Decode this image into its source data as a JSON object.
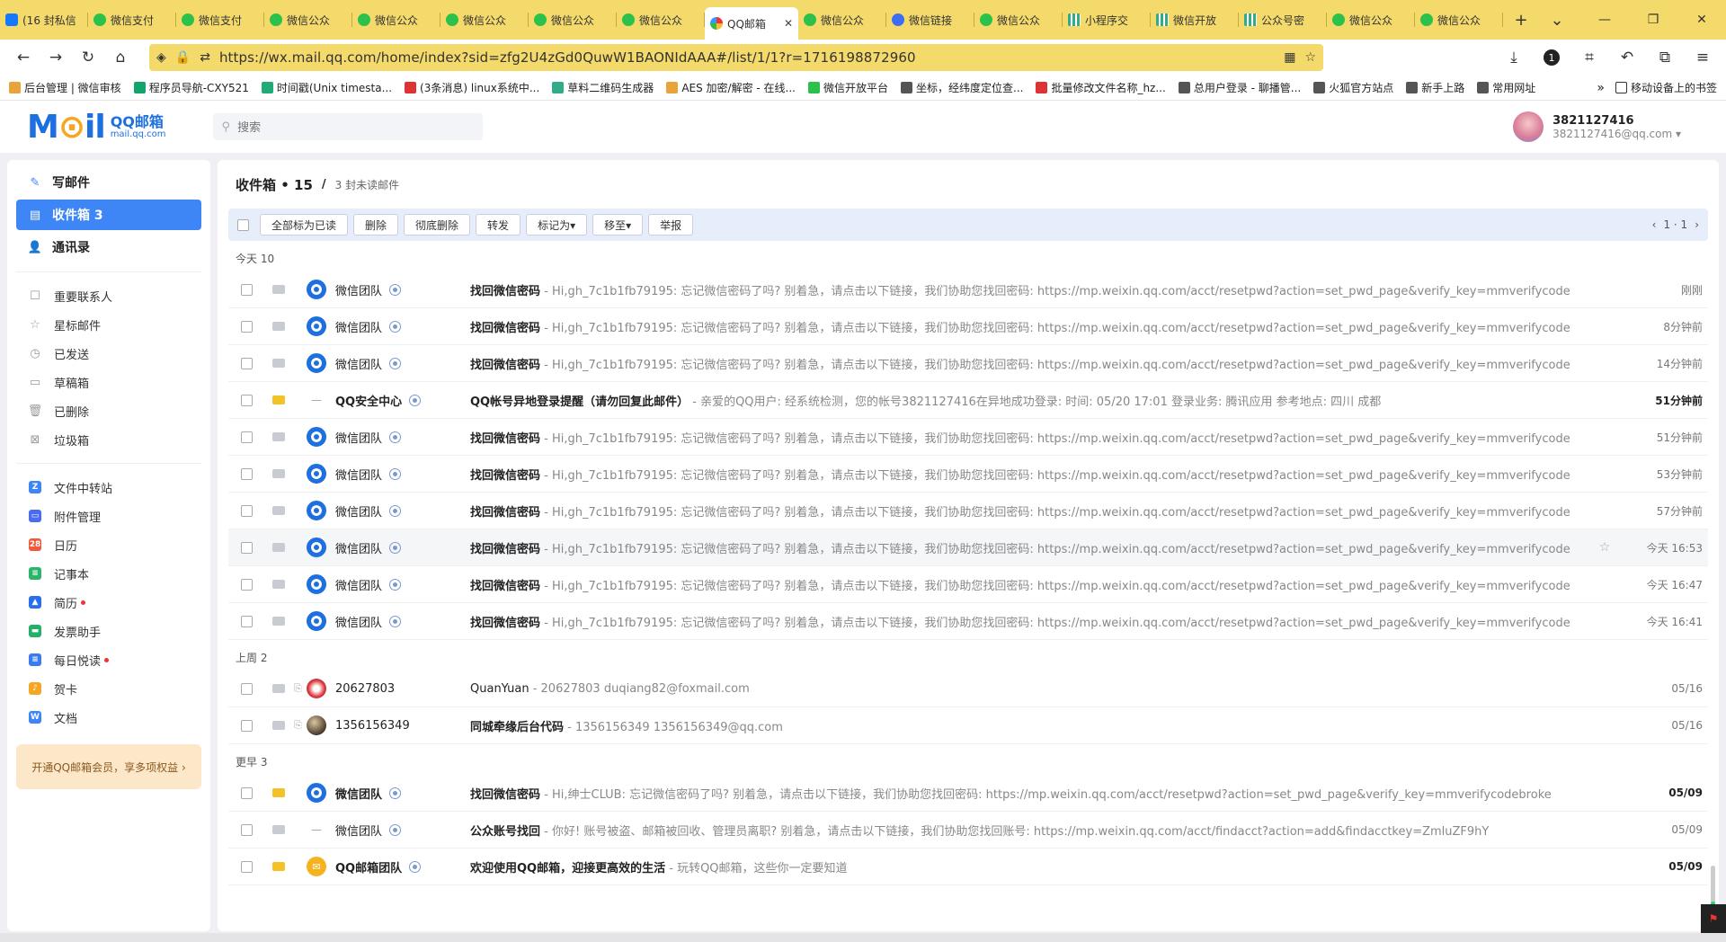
{
  "browser": {
    "tabs": [
      {
        "label": "(16 封私信",
        "icon": "zhi",
        "active": false
      },
      {
        "label": "微信支付",
        "icon": "wx",
        "active": false
      },
      {
        "label": "微信支付",
        "icon": "wx",
        "active": false
      },
      {
        "label": "微信公众",
        "icon": "wx",
        "active": false
      },
      {
        "label": "微信公众",
        "icon": "wx",
        "active": false
      },
      {
        "label": "微信公众",
        "icon": "wx",
        "active": false
      },
      {
        "label": "微信公众",
        "icon": "wx",
        "active": false
      },
      {
        "label": "微信公众",
        "icon": "wx",
        "active": false
      },
      {
        "label": "QQ邮箱",
        "icon": "qq",
        "active": true
      },
      {
        "label": "微信公众",
        "icon": "wx",
        "active": false
      },
      {
        "label": "微信链接",
        "icon": "blue",
        "active": false
      },
      {
        "label": "微信公众",
        "icon": "wx",
        "active": false
      },
      {
        "label": "小程序交",
        "icon": "grid",
        "active": false
      },
      {
        "label": "微信开放",
        "icon": "grid",
        "active": false
      },
      {
        "label": "公众号密",
        "icon": "grid",
        "active": false
      },
      {
        "label": "微信公众",
        "icon": "wx",
        "active": false
      },
      {
        "label": "微信公众",
        "icon": "wx",
        "active": false
      }
    ],
    "url": "https://wx.mail.qq.com/home/index?sid=zfg2U4zGd0QuwW1BAONIdAAA#/list/1/1?r=1716198872960",
    "ext_badge": "1",
    "bookmarks": [
      {
        "label": "后台管理 | 微信审核",
        "color": "#e8a33a"
      },
      {
        "label": "程序员导航-CXY521",
        "color": "#12a56b"
      },
      {
        "label": "时间戳(Unix timesta...",
        "color": "#2a7"
      },
      {
        "label": "(3条消息) linux系统中...",
        "color": "#d33"
      },
      {
        "label": "草料二维码生成器",
        "color": "#3a8"
      },
      {
        "label": "AES 加密/解密 - 在线...",
        "color": "#e8a33a"
      },
      {
        "label": "微信开放平台",
        "color": "#2bc14b"
      },
      {
        "label": "坐标，经纬度定位查...",
        "color": "#555"
      },
      {
        "label": "批量修改文件名称_hz...",
        "color": "#d33"
      },
      {
        "label": "总用户登录 - 聊播管...",
        "color": "#555"
      },
      {
        "label": "火狐官方站点",
        "color": "#555"
      },
      {
        "label": "新手上路",
        "color": "#555"
      },
      {
        "label": "常用网址",
        "color": "#555"
      }
    ],
    "bookmarks_more": "移动设备上的书签"
  },
  "mail": {
    "logo": {
      "brand_pre": "M",
      "brand_o": "⊙",
      "brand_post": "il",
      "name": "QQ邮箱",
      "domain": "mail.qq.com"
    },
    "search_placeholder": "搜索",
    "user": {
      "name": "3821127416",
      "email": "3821127416@qq.com ▾"
    },
    "sidebar": {
      "main": [
        {
          "label": "写邮件",
          "icon": "✎",
          "active": false
        },
        {
          "label": "收件箱 3",
          "icon": "▤",
          "active": true
        },
        {
          "label": "通讯录",
          "icon": "👤",
          "active": false
        }
      ],
      "folders": [
        {
          "label": "重要联系人",
          "icon": "☐"
        },
        {
          "label": "星标邮件",
          "icon": "☆"
        },
        {
          "label": "已发送",
          "icon": "◷"
        },
        {
          "label": "草稿箱",
          "icon": "▭"
        },
        {
          "label": "已删除",
          "icon": "🗑"
        },
        {
          "label": "垃圾箱",
          "icon": "⊠"
        }
      ],
      "apps": [
        {
          "label": "文件中转站",
          "color": "#3e86f5",
          "glyph": "Z",
          "dot": false
        },
        {
          "label": "附件管理",
          "color": "#4a6df0",
          "glyph": "▭",
          "dot": false
        },
        {
          "label": "日历",
          "color": "#f05a3c",
          "glyph": "28",
          "dot": false
        },
        {
          "label": "记事本",
          "color": "#2bb56b",
          "glyph": "≡",
          "dot": false
        },
        {
          "label": "简历",
          "color": "#2a6ef0",
          "glyph": "▲",
          "dot": true
        },
        {
          "label": "发票助手",
          "color": "#25b06a",
          "glyph": "▬",
          "dot": false
        },
        {
          "label": "每日悦读",
          "color": "#3a7bf0",
          "glyph": "≡",
          "dot": true
        },
        {
          "label": "贺卡",
          "color": "#f5a623",
          "glyph": "♪",
          "dot": false
        },
        {
          "label": "文档",
          "color": "#3e86f5",
          "glyph": "W",
          "dot": false
        }
      ],
      "vip": "开通QQ邮箱会员，享多项权益 ›"
    },
    "inbox": {
      "title": "收件箱 • 15",
      "separator": "/",
      "unread": "3 封未读邮件",
      "toolbar": [
        "全部标为已读",
        "删除",
        "彻底删除",
        "转发",
        "标记为▾",
        "移至▾",
        "举报"
      ],
      "pager": "1 · 1",
      "groups": [
        {
          "label": "今天 10",
          "rows": [
            {
              "sender": "微信团队",
              "sicon": "wx",
              "verified": true,
              "subject": "找回微信密码",
              "preview": " - Hi,gh_7c1b1fb79195:  忘记微信密码了吗? 别着急，请点击以下链接，我们协助您找回密码:  https://mp.weixin.qq.com/acct/resetpwd?action=set_pwd_page&verify_key=mmverifycode",
              "time": "刚刚",
              "unread": false,
              "bold": false
            },
            {
              "sender": "微信团队",
              "sicon": "wx",
              "verified": true,
              "subject": "找回微信密码",
              "preview": " - Hi,gh_7c1b1fb79195:  忘记微信密码了吗? 别着急，请点击以下链接，我们协助您找回密码:  https://mp.weixin.qq.com/acct/resetpwd?action=set_pwd_page&verify_key=mmverifycode",
              "time": "8分钟前",
              "unread": false,
              "bold": false
            },
            {
              "sender": "微信团队",
              "sicon": "wx",
              "verified": true,
              "subject": "找回微信密码",
              "preview": " - Hi,gh_7c1b1fb79195:  忘记微信密码了吗? 别着急，请点击以下链接，我们协助您找回密码:  https://mp.weixin.qq.com/acct/resetpwd?action=set_pwd_page&verify_key=mmverifycode",
              "time": "14分钟前",
              "unread": false,
              "bold": false
            },
            {
              "sender": "QQ安全中心",
              "sicon": "dash",
              "verified": true,
              "subject": "QQ帐号异地登录提醒（请勿回复此邮件）",
              "preview": " - 亲爱的QQ用户:      经系统检测，您的帐号3821127416在异地成功登录:     时间: 05/20 17:01     登录业务: 腾讯应用     参考地点: 四川 成都",
              "time": "51分钟前",
              "unread": true,
              "bold": true
            },
            {
              "sender": "微信团队",
              "sicon": "wx",
              "verified": true,
              "subject": "找回微信密码",
              "preview": " - Hi,gh_7c1b1fb79195:  忘记微信密码了吗? 别着急，请点击以下链接，我们协助您找回密码:  https://mp.weixin.qq.com/acct/resetpwd?action=set_pwd_page&verify_key=mmverifycode",
              "time": "51分钟前",
              "unread": false,
              "bold": false
            },
            {
              "sender": "微信团队",
              "sicon": "wx",
              "verified": true,
              "subject": "找回微信密码",
              "preview": " - Hi,gh_7c1b1fb79195:  忘记微信密码了吗? 别着急，请点击以下链接，我们协助您找回密码:  https://mp.weixin.qq.com/acct/resetpwd?action=set_pwd_page&verify_key=mmverifycode",
              "time": "53分钟前",
              "unread": false,
              "bold": false
            },
            {
              "sender": "微信团队",
              "sicon": "wx",
              "verified": true,
              "subject": "找回微信密码",
              "preview": " - Hi,gh_7c1b1fb79195:  忘记微信密码了吗? 别着急，请点击以下链接，我们协助您找回密码:  https://mp.weixin.qq.com/acct/resetpwd?action=set_pwd_page&verify_key=mmverifycode",
              "time": "57分钟前",
              "unread": false,
              "bold": false
            },
            {
              "sender": "微信团队",
              "sicon": "wx",
              "verified": true,
              "subject": "找回微信密码",
              "preview": " - Hi,gh_7c1b1fb79195:  忘记微信密码了吗? 别着急，请点击以下链接，我们协助您找回密码:  https://mp.weixin.qq.com/acct/resetpwd?action=set_pwd_page&verify_key=mmverifycode",
              "time": "今天 16:53",
              "unread": false,
              "bold": false,
              "hover": true
            },
            {
              "sender": "微信团队",
              "sicon": "wx",
              "verified": true,
              "subject": "找回微信密码",
              "preview": " - Hi,gh_7c1b1fb79195:  忘记微信密码了吗? 别着急，请点击以下链接，我们协助您找回密码:  https://mp.weixin.qq.com/acct/resetpwd?action=set_pwd_page&verify_key=mmverifycode",
              "time": "今天 16:47",
              "unread": false,
              "bold": false
            },
            {
              "sender": "微信团队",
              "sicon": "wx",
              "verified": true,
              "subject": "找回微信密码",
              "preview": " - Hi,gh_7c1b1fb79195:  忘记微信密码了吗? 别着急，请点击以下链接，我们协助您找回密码:  https://mp.weixin.qq.com/acct/resetpwd?action=set_pwd_page&verify_key=mmverifycode",
              "time": "今天 16:41",
              "unread": false,
              "bold": false
            }
          ]
        },
        {
          "label": "上周 2",
          "rows": [
            {
              "sender": "20627803",
              "sicon": "red",
              "verified": false,
              "attach": true,
              "subject": "QuanYuan",
              "subject_plain": true,
              "preview": " - 20627803 duqiang82@foxmail.com",
              "time": "05/16",
              "unread": false,
              "bold": false
            },
            {
              "sender": "1356156349",
              "sicon": "photo",
              "verified": false,
              "attach": true,
              "subject": "同城牵缘后台代码",
              "preview": " - 1356156349 1356156349@qq.com",
              "time": "05/16",
              "unread": false,
              "bold": false
            }
          ]
        },
        {
          "label": "更早 3",
          "rows": [
            {
              "sender": "微信团队",
              "sicon": "wx",
              "verified": true,
              "subject": "找回微信密码",
              "preview": " - Hi,绅士CLUB:  忘记微信密码了吗? 别着急，请点击以下链接，我们协助您找回密码:  https://mp.weixin.qq.com/acct/resetpwd?action=set_pwd_page&verify_key=mmverifycodebroke",
              "time": "05/09",
              "unread": true,
              "bold": true
            },
            {
              "sender": "微信团队",
              "sicon": "dash",
              "verified": true,
              "subject": "公众账号找回",
              "preview": " - 你好! 账号被盗、邮箱被回收、管理员离职? 别着急，请点击以下链接，我们协助您找回账号:  https://mp.weixin.qq.com/acct/findacct?action=add&findacctkey=ZmluZF9hY",
              "time": "05/09",
              "unread": false,
              "bold": false
            },
            {
              "sender": "QQ邮箱团队",
              "sicon": "qqmail",
              "verified": true,
              "subject": "欢迎使用QQ邮箱，迎接更高效的生活",
              "preview": " - 玩转QQ邮箱，这些你一定要知道",
              "time": "05/09",
              "unread": true,
              "bold": true
            }
          ]
        }
      ]
    }
  }
}
